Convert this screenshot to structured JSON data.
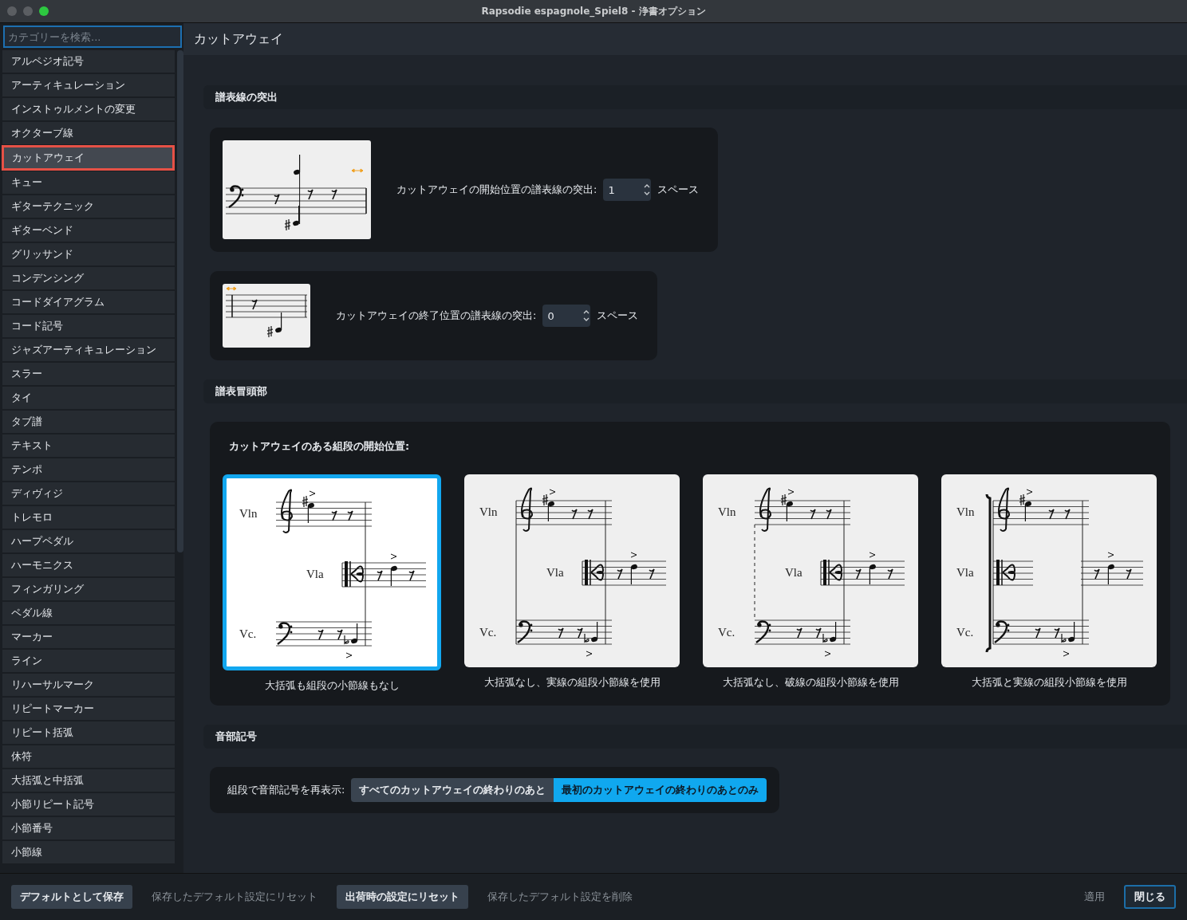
{
  "window": {
    "title": "Rapsodie espagnole_Spiel8 - 浄書オプション"
  },
  "search": {
    "placeholder": "カテゴリーを検索..."
  },
  "sidebar": {
    "items": [
      {
        "label": "アルペジオ記号",
        "selected": false
      },
      {
        "label": "アーティキュレーション",
        "selected": false
      },
      {
        "label": "インストゥルメントの変更",
        "selected": false
      },
      {
        "label": "オクターブ線",
        "selected": false
      },
      {
        "label": "カットアウェイ",
        "selected": true
      },
      {
        "label": "キュー",
        "selected": false
      },
      {
        "label": "ギターテクニック",
        "selected": false
      },
      {
        "label": "ギターベンド",
        "selected": false
      },
      {
        "label": "グリッサンド",
        "selected": false
      },
      {
        "label": "コンデンシング",
        "selected": false
      },
      {
        "label": "コードダイアグラム",
        "selected": false
      },
      {
        "label": "コード記号",
        "selected": false
      },
      {
        "label": "ジャズアーティキュレーション",
        "selected": false
      },
      {
        "label": "スラー",
        "selected": false
      },
      {
        "label": "タイ",
        "selected": false
      },
      {
        "label": "タブ譜",
        "selected": false
      },
      {
        "label": "テキスト",
        "selected": false
      },
      {
        "label": "テンポ",
        "selected": false
      },
      {
        "label": "ディヴィジ",
        "selected": false
      },
      {
        "label": "トレモロ",
        "selected": false
      },
      {
        "label": "ハープペダル",
        "selected": false
      },
      {
        "label": "ハーモニクス",
        "selected": false
      },
      {
        "label": "フィンガリング",
        "selected": false
      },
      {
        "label": "ペダル線",
        "selected": false
      },
      {
        "label": "マーカー",
        "selected": false
      },
      {
        "label": "ライン",
        "selected": false
      },
      {
        "label": "リハーサルマーク",
        "selected": false
      },
      {
        "label": "リピートマーカー",
        "selected": false
      },
      {
        "label": "リピート括弧",
        "selected": false
      },
      {
        "label": "休符",
        "selected": false
      },
      {
        "label": "大括弧と中括弧",
        "selected": false
      },
      {
        "label": "小節リピート記号",
        "selected": false
      },
      {
        "label": "小節番号",
        "selected": false
      },
      {
        "label": "小節線",
        "selected": false
      }
    ]
  },
  "page": {
    "title": "カットアウェイ"
  },
  "sections": [
    {
      "kind": "steppers",
      "title": "譜表線の突出",
      "rows": [
        {
          "kind": "start",
          "label": "カットアウェイの開始位置の譜表線の突出:",
          "value": "1",
          "unit": "スペース"
        },
        {
          "kind": "end",
          "label": "カットアウェイの終了位置の譜表線の突出:",
          "value": "0",
          "unit": "スペース"
        }
      ]
    },
    {
      "kind": "choices",
      "title": "譜表冒頭部",
      "label": "カットアウェイのある組段の開始位置:",
      "options": [
        {
          "kind": "none",
          "caption": "大括弧も組段の小節線もなし",
          "selected": true,
          "instruments": [
            "Vln",
            "Vla",
            "Vc."
          ]
        },
        {
          "kind": "solid",
          "caption": "大括弧なし、実線の組段小節線を使用",
          "selected": false,
          "instruments": [
            "Vln",
            "Vla",
            "Vc."
          ]
        },
        {
          "kind": "dashed",
          "caption": "大括弧なし、破線の組段小節線を使用",
          "selected": false,
          "instruments": [
            "Vln",
            "Vla",
            "Vc."
          ]
        },
        {
          "kind": "bracket",
          "caption": "大括弧と実線の組段小節線を使用",
          "selected": false,
          "instruments": [
            "Vln",
            "Vla",
            "Vc."
          ]
        }
      ]
    },
    {
      "kind": "segmented",
      "title": "音部記号",
      "label": "組段で音部記号を再表示:",
      "options": [
        {
          "label": "すべてのカットアウェイの終わりのあと",
          "selected": false
        },
        {
          "label": "最初のカットアウェイの終わりのあとのみ",
          "selected": true
        }
      ]
    }
  ],
  "footer": {
    "left": [
      {
        "kind": "button",
        "label": "デフォルトとして保存",
        "disabled": false
      },
      {
        "kind": "button",
        "label": "保存したデフォルト設定にリセット",
        "disabled": true
      },
      {
        "kind": "button",
        "label": "出荷時の設定にリセット",
        "disabled": false
      },
      {
        "kind": "button",
        "label": "保存したデフォルト設定を削除",
        "disabled": true
      }
    ],
    "right": [
      {
        "kind": "button",
        "label": "適用",
        "disabled": true
      },
      {
        "kind": "primary",
        "label": "閉じる",
        "disabled": false
      }
    ]
  }
}
